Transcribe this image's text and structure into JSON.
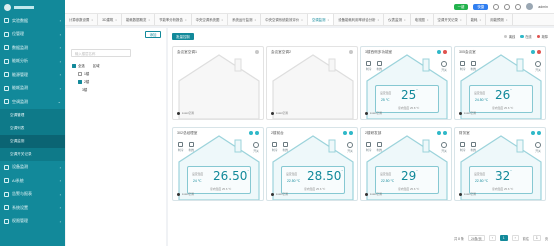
{
  "sidebar": {
    "items": [
      {
        "label": "实验数据",
        "icon": "grid-icon"
      },
      {
        "label": "位管理",
        "icon": "user-icon"
      },
      {
        "label": "数据监测",
        "icon": "monitor-icon"
      },
      {
        "label": "能耗分析",
        "icon": "chart-icon"
      },
      {
        "label": "能源管理",
        "icon": "energy-icon"
      },
      {
        "label": "能耗监测",
        "icon": "meter-icon"
      },
      {
        "label": "空调监测",
        "icon": "ac-icon"
      }
    ],
    "sub_items": [
      {
        "label": "空调管理",
        "active": false
      },
      {
        "label": "空调列表",
        "active": false
      },
      {
        "label": "空调监测",
        "active": true
      },
      {
        "label": "空调开关记录",
        "active": false
      }
    ],
    "bottom_items": [
      {
        "label": "设备监测",
        "icon": "device-icon"
      },
      {
        "label": "AI系统",
        "icon": "ai-icon"
      },
      {
        "label": "告警与报表",
        "icon": "alarm-icon"
      },
      {
        "label": "系统设置",
        "icon": "gear-icon"
      },
      {
        "label": "权限管理",
        "icon": "lock-icon"
      }
    ]
  },
  "header": {
    "badge_green": "一键",
    "badge_blue": "快捷",
    "user_name": "admin"
  },
  "tabs": [
    {
      "label": "计算参数设置",
      "active": false
    },
    {
      "label": "3D建筑",
      "active": false
    },
    {
      "label": "能耗数据概览",
      "active": false
    },
    {
      "label": "节能率分析报告",
      "active": false
    },
    {
      "label": "中央空调系统图",
      "active": false
    },
    {
      "label": "系统运行监测",
      "active": false
    },
    {
      "label": "中央空调系统能效评价",
      "active": false
    },
    {
      "label": "空调监测",
      "active": true
    },
    {
      "label": "设备能耗利用率综合分析",
      "active": false
    },
    {
      "label": "仪表监测",
      "active": false
    },
    {
      "label": "电流图",
      "active": false
    },
    {
      "label": "空调开关记录",
      "active": false
    },
    {
      "label": "能耗",
      "active": false
    },
    {
      "label": "用能预测",
      "active": false
    }
  ],
  "tree": {
    "add_button": "添加",
    "search_placeholder": "输入楼层名称",
    "rows": [
      {
        "label": "全选",
        "sub": "区域",
        "checked": true
      },
      {
        "label": "1楼",
        "checked": false
      },
      {
        "label": "2楼",
        "checked": true
      },
      {
        "label": "3楼",
        "checked": false
      }
    ]
  },
  "main": {
    "batch_button": "批量控制",
    "legend": [
      {
        "label": "离线",
        "color": "#c8c8c8"
      },
      {
        "label": "在线",
        "color": "#2fb8c8"
      },
      {
        "label": "故障",
        "color": "#e0534f"
      }
    ],
    "cards": [
      {
        "title": "会议室空调1",
        "online": false,
        "set": "",
        "room": "",
        "small": ""
      },
      {
        "title": "会议室空调2",
        "online": false,
        "set": "",
        "room": "",
        "small": ""
      },
      {
        "title": "3楼西侧多功能室",
        "online": true,
        "set": "25",
        "room": "室内温度 25.8 ℃",
        "small": "25 ℃"
      },
      {
        "title": "305会议室",
        "online": true,
        "set": "26",
        "room": "室内温度 25.6 ℃",
        "small": "24.50 ℃"
      },
      {
        "title": "302总经理室",
        "online": true,
        "set": "26.50",
        "room": "室内温度 25.6 ℃",
        "small": "24 ℃"
      },
      {
        "title": "2楼前台",
        "online": true,
        "set": "28.50",
        "room": "室内温度 25.6 ℃",
        "small": "22.50 ℃"
      },
      {
        "title": "2楼研发部",
        "online": true,
        "set": "29",
        "room": "室内温度 25.6 ℃",
        "small": "22.50 ℃"
      },
      {
        "title": "财务室",
        "online": true,
        "set": "32",
        "room": "室内温度 25.6 ℃",
        "small": "22.50 ℃"
      }
    ],
    "mode_labels": [
      "制冷",
      "制热",
      "送风"
    ],
    "power_label": "开关",
    "set_label": "设定温度",
    "brand": "Lxxxx空调",
    "pager": {
      "total": "共 8 条",
      "per_page": "24条/页",
      "pages": [
        "1"
      ],
      "goto": "前往",
      "page_unit": "页"
    }
  }
}
